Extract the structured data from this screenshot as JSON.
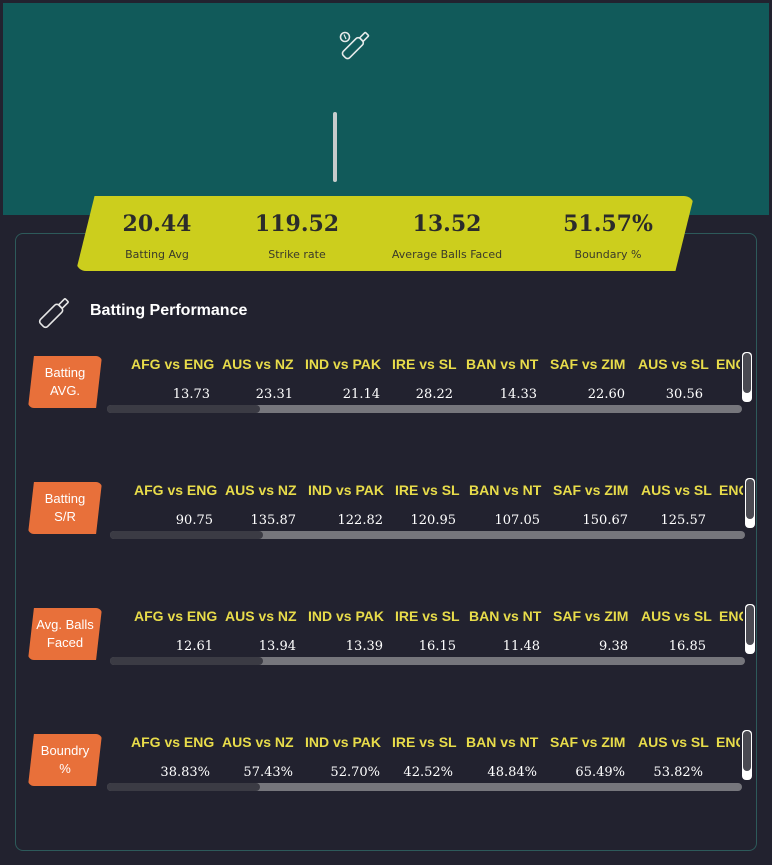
{
  "header": {
    "icon": "cricket-bat-icon"
  },
  "stats": [
    {
      "value": "20.44",
      "label": "Batting Avg"
    },
    {
      "value": "119.52",
      "label": "Strike rate"
    },
    {
      "value": "13.52",
      "label": "Average Balls Faced"
    },
    {
      "value": "51.57%",
      "label": "Boundary %"
    }
  ],
  "section": {
    "title": "Batting Performance",
    "icon": "cricket-bat-icon"
  },
  "matches": [
    "AFG vs ENG",
    "AUS vs NZ",
    "IND vs PAK",
    "IRE vs SL",
    "BAN vs NT",
    "SAF vs ZIM",
    "AUS vs SL",
    "ENG"
  ],
  "metrics": [
    {
      "label": "Batting\nAVG.",
      "values": [
        "13.73",
        "23.31",
        "21.14",
        "28.22",
        "14.33",
        "22.60",
        "30.56"
      ],
      "scroll_position": 0
    },
    {
      "label": "Batting\nS/R",
      "values": [
        "90.75",
        "135.87",
        "122.82",
        "120.95",
        "107.05",
        "150.67",
        "125.57"
      ],
      "scroll_position": 0
    },
    {
      "label": "Avg. Balls\nFaced",
      "values": [
        "12.61",
        "13.94",
        "13.39",
        "16.15",
        "11.48",
        "9.38",
        "16.85"
      ],
      "scroll_position": 0
    },
    {
      "label": "Boundry\n%",
      "values": [
        "38.83%",
        "57.43%",
        "52.70%",
        "42.52%",
        "48.84%",
        "65.49%",
        "53.82%"
      ],
      "scroll_position": 0
    }
  ],
  "colors": {
    "header_bg": "#115a5a",
    "page_bg": "#22222f",
    "stats_banner": "#ccce1d",
    "metric_badge": "#e8703a",
    "match_header_text": "#e8dc4a"
  }
}
